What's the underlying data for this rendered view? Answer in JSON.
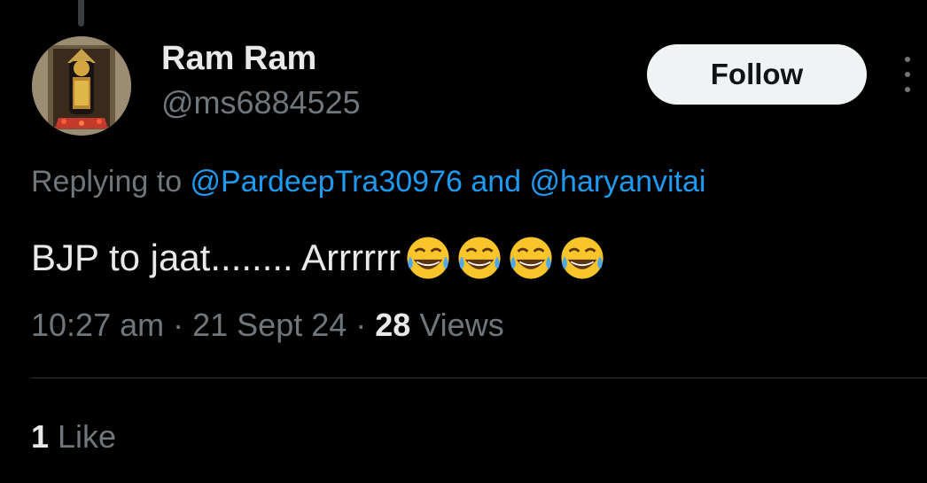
{
  "user": {
    "display_name": "Ram Ram",
    "handle": "@ms6884525",
    "avatar_icon": "deity-idol-avatar"
  },
  "actions": {
    "follow_label": "Follow",
    "more_icon": "more-vertical-icon"
  },
  "reply": {
    "prefix": "Replying to ",
    "mention_1": "@PardeepTra30976",
    "conjunction": " and ",
    "mention_2": "@haryanvitai"
  },
  "tweet": {
    "text": "BJP to jaat........ Arrrrrr",
    "emojis": [
      "face-with-tears-of-joy",
      "face-with-tears-of-joy",
      "face-with-tears-of-joy",
      "face-with-tears-of-joy"
    ]
  },
  "meta": {
    "time": "10:27 am",
    "separator": " · ",
    "date": "21 Sept 24",
    "views_count": "28",
    "views_label": " Views"
  },
  "engagement": {
    "likes_count": "1",
    "likes_label": " Like"
  },
  "colors": {
    "background": "#000000",
    "text_primary": "#e7e9ea",
    "text_secondary": "#71767b",
    "link": "#1d9bf0",
    "button_bg": "#eff3f4",
    "divider": "#2f3336"
  }
}
